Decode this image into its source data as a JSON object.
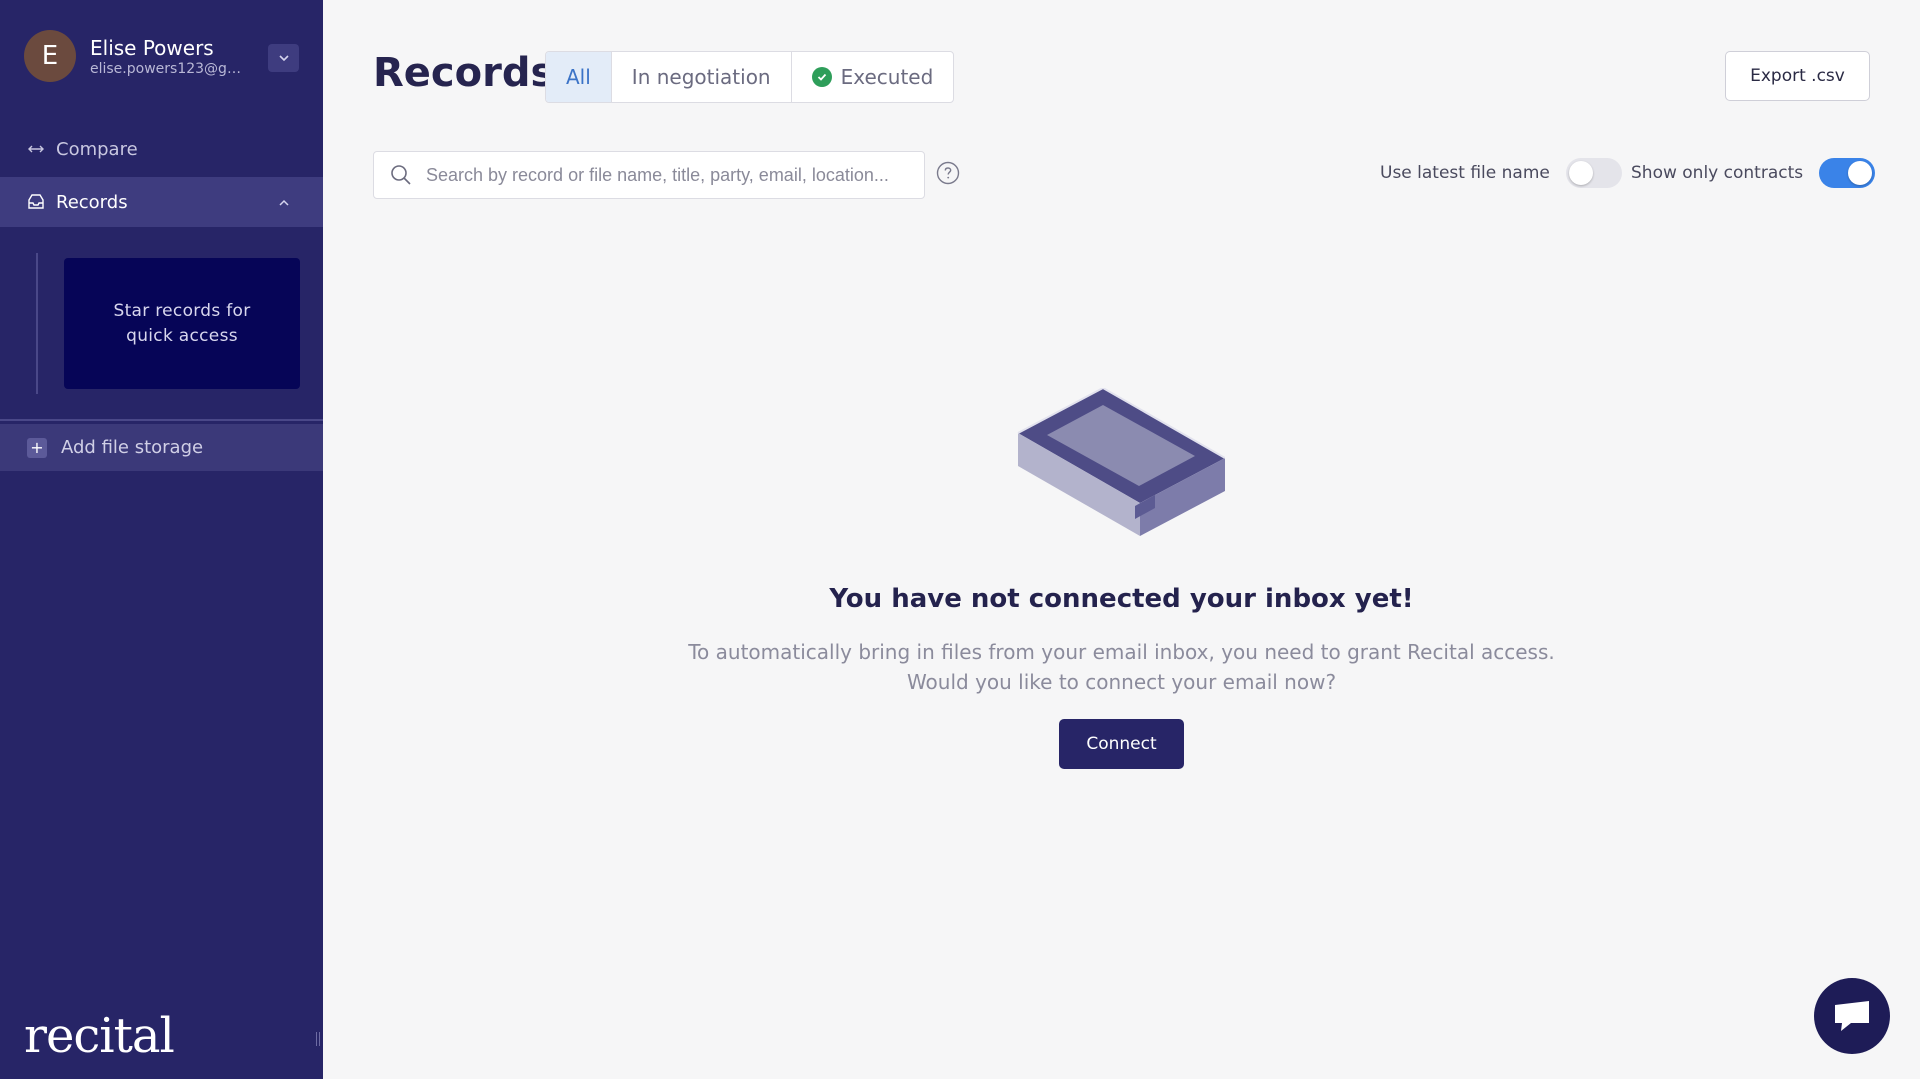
{
  "user": {
    "initial": "E",
    "name": "Elise Powers",
    "email": "elise.powers123@gm..."
  },
  "sidebar": {
    "items": [
      {
        "label": "Compare",
        "icon": "compare-arrows-icon"
      },
      {
        "label": "Records",
        "icon": "records-inbox-icon"
      }
    ],
    "star_hint": "Star records for quick access",
    "add_storage_label": "Add file storage",
    "brand": "recital"
  },
  "header": {
    "title": "Records",
    "tabs": [
      {
        "label": "All",
        "active": true
      },
      {
        "label": "In negotiation",
        "active": false
      },
      {
        "label": "Executed",
        "active": false,
        "icon": "check-circle-icon"
      }
    ],
    "export_label": "Export .csv"
  },
  "search": {
    "placeholder": "Search by record or file name, title, party, email, location..."
  },
  "toggles": {
    "latest_file_name": {
      "label": "Use latest file name",
      "on": false
    },
    "only_contracts": {
      "label": "Show only contracts",
      "on": true
    }
  },
  "empty_state": {
    "title": "You have not connected your inbox yet!",
    "line1": "To automatically bring in files from your email inbox, you need to grant Recital access.",
    "line2": "Would you like to connect your email now?",
    "button": "Connect"
  },
  "colors": {
    "sidebar_bg": "#272567",
    "accent_blue": "#3a83e8",
    "success_green": "#2e9e5a"
  }
}
